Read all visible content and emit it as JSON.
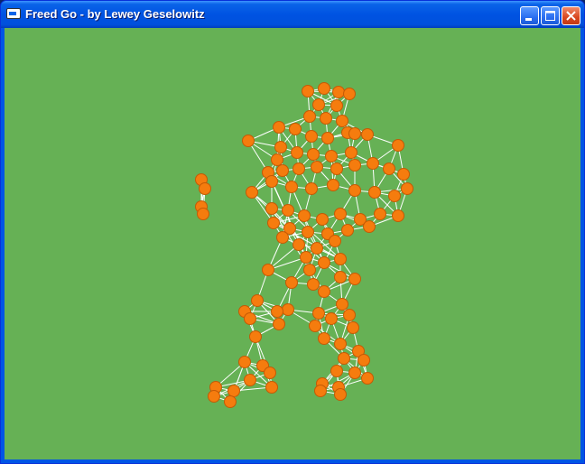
{
  "window": {
    "title": "Freed Go - by Lewey Geselowitz",
    "buttons": {
      "minimize": "minimize-icon",
      "maximize": "maximize-icon",
      "close": "close-icon"
    }
  },
  "scene": {
    "background_color": "#66b155",
    "node_color": "#f57c0e",
    "edge_color": "#ffffff",
    "description_icon": "articulated-figure"
  }
}
